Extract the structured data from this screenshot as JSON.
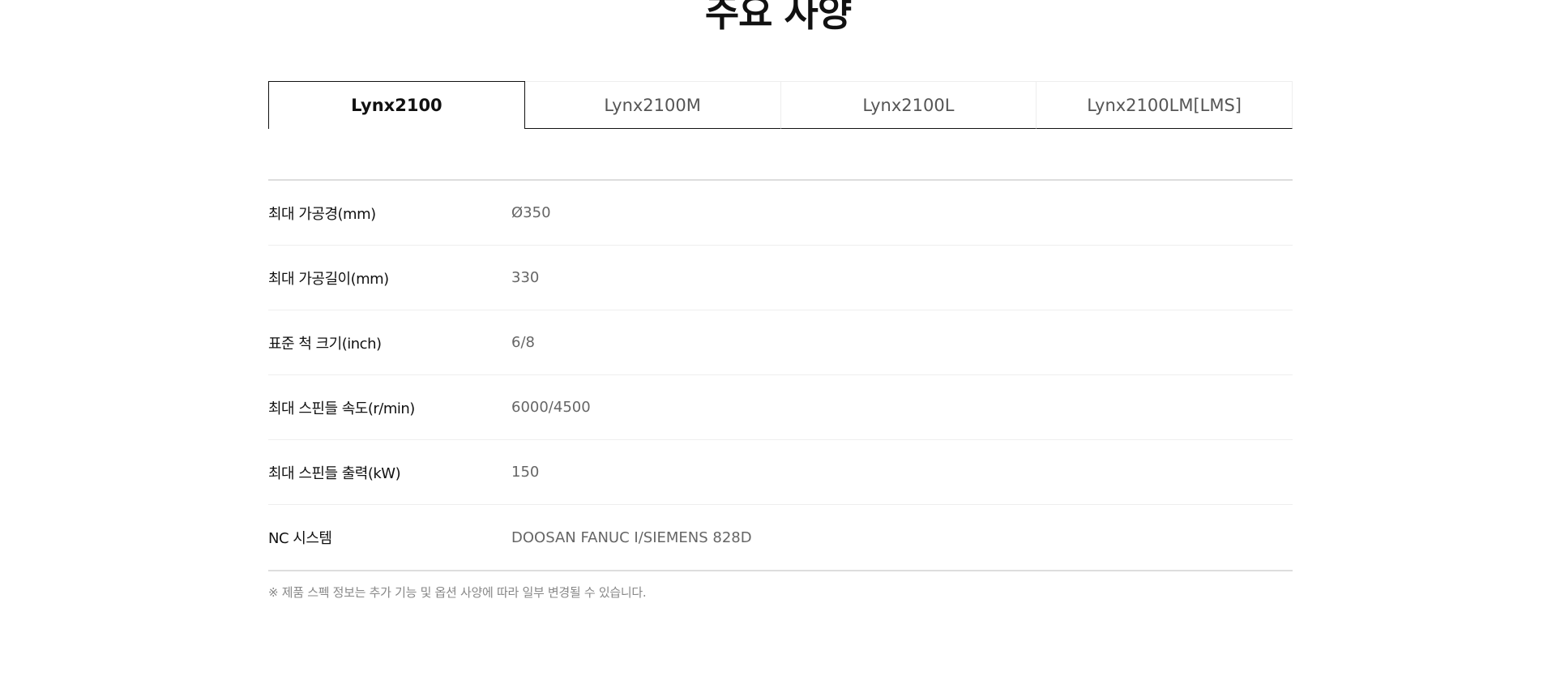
{
  "section": {
    "title": "주요 사양"
  },
  "tabs": [
    {
      "label": "Lynx2100",
      "active": true
    },
    {
      "label": "Lynx2100M",
      "active": false
    },
    {
      "label": "Lynx2100L",
      "active": false
    },
    {
      "label": "Lynx2100LM[LMS]",
      "active": false
    }
  ],
  "specs": [
    {
      "label": "최대 가공경(mm)",
      "value": "Ø350"
    },
    {
      "label": "최대 가공길이(mm)",
      "value": "330"
    },
    {
      "label": "표준 척 크기(inch)",
      "value": "6/8"
    },
    {
      "label": "최대 스핀들 속도(r/min)",
      "value": "6000/4500"
    },
    {
      "label": "최대 스핀들 출력(kW)",
      "value": "150"
    },
    {
      "label": "NC 시스템",
      "value": "DOOSAN FANUC I/SIEMENS 828D"
    }
  ],
  "notice": "※ 제품 스펙 정보는 추가 기능 및 옵션 사양에 따라 일부 변경될 수 있습니다.",
  "colors": {
    "title": "#111111",
    "tab_active_border": "#111111",
    "value_text": "#666666",
    "notice_text": "#888888"
  }
}
